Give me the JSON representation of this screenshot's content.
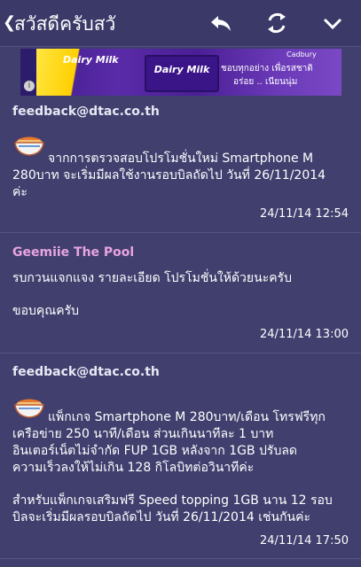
{
  "topbar": {
    "back_glyph": "❮",
    "title": "สวัสดีครับสวั",
    "icons": [
      "reply-icon",
      "refresh-icon",
      "chevron-down-icon"
    ]
  },
  "ad": {
    "brand_left": "Dairy Milk",
    "brand_bar": "Dairy Milk",
    "tag": "Cadbury",
    "line1": "ชอบทุกอย่าง เพื่อรสชาติ",
    "line2": "อร่อย .. เนียนนุ่ม",
    "info": "i"
  },
  "messages": [
    {
      "sender": "feedback@dtac.co.th",
      "lines": [
        "จากการตรวจสอบโปรโมชั่นใหม่ Smartphone M",
        "280บาท จะเริ่มมีผลใช้งานรอบบิลถัดไป วันที่ 26/11/2014",
        "ค่ะ"
      ],
      "time": "24/11/14 12:54"
    },
    {
      "sender": "Geemiie The Pool",
      "lines": [
        "รบกวนแจกแจง รายละเอียด โปรโมชั่นให้ด้วยนะครับ",
        "ขอบคุณครับ"
      ],
      "time": "24/11/14 13:00"
    },
    {
      "sender": "feedback@dtac.co.th",
      "lines": [
        "แพ็กเกจ Smartphone M 280บาท/เดือน โทรฟรีทุก",
        "เครือข่าย 250 นาที/เดือน ส่วนเกินนาทีละ 1 บาท",
        "อินเตอร์เน็ตไม่จำกัด FUP 1GB หลังจาก 1GB ปรับลด",
        "ความเร็วลงให้ไม่เกิน 128 กิโลบิทต่อวินาทีค่ะ",
        "สำหรับแพ็กเกจเสริมฟรี Speed topping 1GB นาน 12 รอบ",
        "บิลจะเริ่มมีผลรอบบิลถัดไป วันที่ 26/11/2014 เช่นกันค่ะ"
      ],
      "time": "24/11/14 17:50"
    }
  ],
  "colors": {
    "background": "#403f6e",
    "topbar": "#3a3968",
    "sender_pink": "#e8a4e0",
    "text": "#ffffff"
  }
}
